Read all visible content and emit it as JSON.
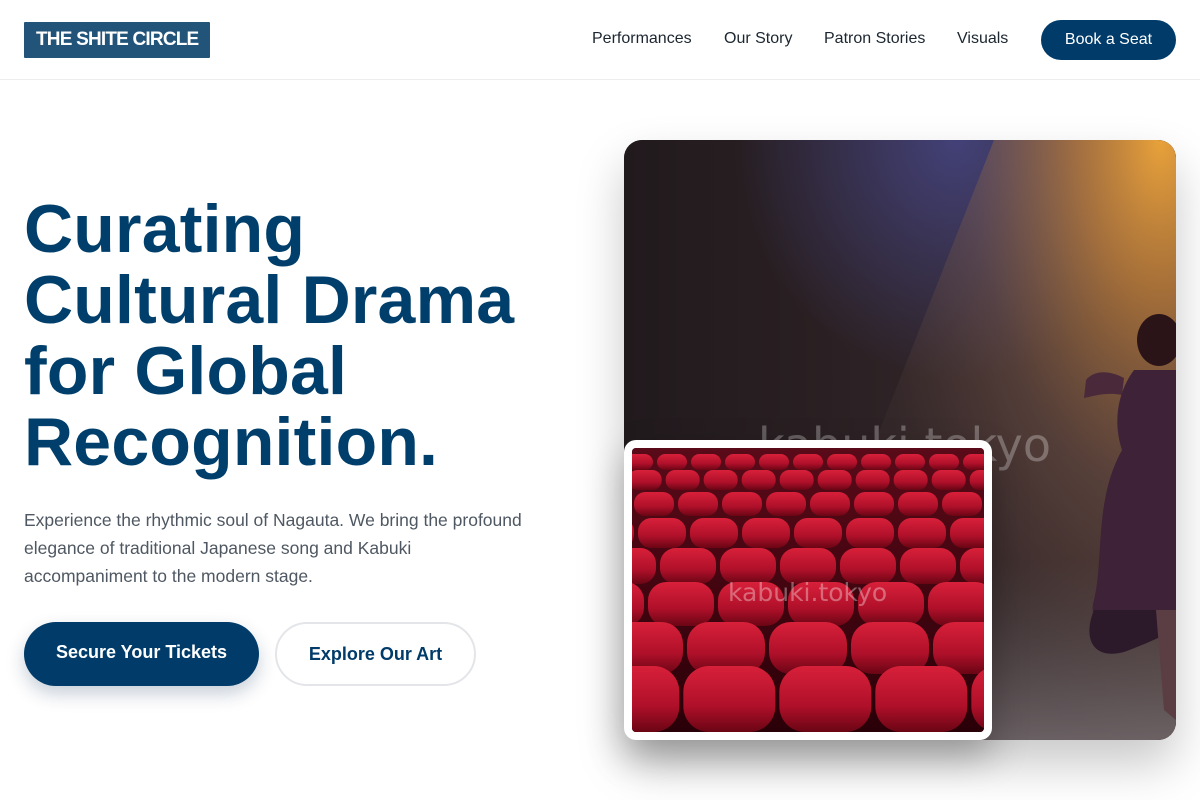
{
  "header": {
    "logo": "THE SHITE CIRCLE",
    "nav": [
      "Performances",
      "Our Story",
      "Patron Stories",
      "Visuals"
    ],
    "cta": "Book a Seat"
  },
  "hero": {
    "title_lines": [
      "Curating",
      "Cultural Drama",
      "for Global",
      "Recognition."
    ],
    "subtitle_lines": [
      "Experience the rhythmic soul of Nagauta. We bring the profound",
      "elegance of traditional Japanese song and Kabuki",
      "accompaniment to the modern stage."
    ],
    "primary_button": "Secure Your Tickets",
    "secondary_button": "Explore Our Art"
  },
  "images": {
    "main_watermark": "kabuki.tokyo",
    "inset_watermark": "kabuki.tokyo"
  },
  "colors": {
    "brand": "#003b69",
    "logo_bg": "#22547a",
    "title": "#003f6b",
    "body_text": "#4f5862",
    "seat_red": "#c0142a"
  }
}
